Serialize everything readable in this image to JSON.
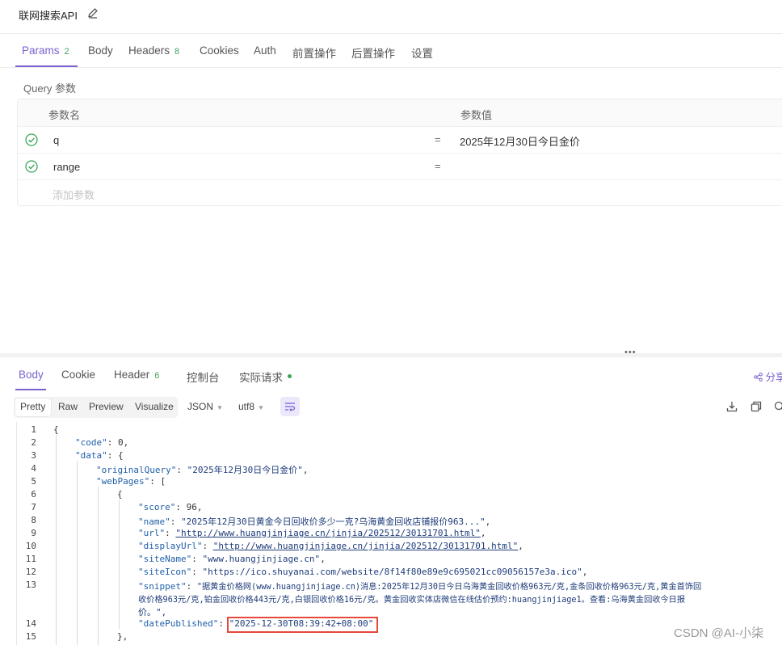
{
  "header": {
    "title": "联网搜索API"
  },
  "request_tabs": {
    "params": "Params",
    "params_count": "2",
    "body": "Body",
    "headers": "Headers",
    "headers_count": "8",
    "cookies": "Cookies",
    "auth": "Auth",
    "pre_ops": "前置操作",
    "post_ops": "后置操作",
    "settings": "设置"
  },
  "query": {
    "title": "Query 参数",
    "col_name": "参数名",
    "col_value": "参数值",
    "rows": [
      {
        "key": "q",
        "eq": "=",
        "value": "2025年12月30日今日金价"
      },
      {
        "key": "range",
        "eq": "=",
        "value": ""
      }
    ],
    "add_placeholder": "添加参数"
  },
  "splitter": {
    "dots": "•••"
  },
  "response_tabs": {
    "body": "Body",
    "cookie": "Cookie",
    "header": "Header",
    "header_count": "6",
    "console": "控制台",
    "actual_request": "实际请求",
    "share": "分享"
  },
  "toolbar": {
    "views": [
      "Pretty",
      "Raw",
      "Preview",
      "Visualize"
    ],
    "format": "JSON",
    "encoding": "utf8"
  },
  "code": {
    "line_numbers": [
      "1",
      "2",
      "3",
      "4",
      "5",
      "6",
      "7",
      "8",
      "9",
      "10",
      "11",
      "12",
      "13",
      "",
      "14",
      "15"
    ],
    "l1": "{",
    "l2_key": "\"code\"",
    "l2_val": "0",
    "l3_key": "\"data\"",
    "l3_rest": ": {",
    "l4_key": "\"originalQuery\"",
    "l4_val": "\"2025年12月30日今日金价\"",
    "l5_key": "\"webPages\"",
    "l5_rest": ": [",
    "l6": "{",
    "l7_key": "\"score\"",
    "l7_val": "96",
    "l8_key": "\"name\"",
    "l8_val": "\"2025年12月30日黄金今日回收价多少一克?乌海黄金回收店铺报价963...\"",
    "l9_key": "\"url\"",
    "l9_val": "\"http://www.huangjinjiage.cn/jinjia/202512/30131701.html\"",
    "l10_key": "\"displayUrl\"",
    "l10_val": "\"http://www.huangjinjiage.cn/jinjia/202512/30131701.html\"",
    "l11_key": "\"siteName\"",
    "l11_val": "\"www.huangjinjiage.cn\"",
    "l12_key": "\"siteIcon\"",
    "l12_val": "\"https://ico.shuyanai.com/website/8f14f80e89e9c695021cc09056157e3a.ico\"",
    "l13_key": "\"snippet\"",
    "l13_val_1": "\"据黄金价格网(www.huangjinjiage.cn)消息:2025年12月30日今日乌海黄金回收价格963元/克,金条回收价格963元/克,黄金首饰回",
    "l13_val_2": "收价格963元/克,铂金回收价格443元/克,白银回收价格16元/克。黄金回收实体店微信在线估价预约:huangjinjiage1。查看:乌海黄金回收今日报",
    "l13_val_3": "价。\",",
    "l14_key": "\"datePublished\"",
    "l14_val": "\"2025-12-30T08:39:42+08:00\"",
    "l15": "},"
  },
  "watermark": "CSDN @AI-小柒",
  "colors": {
    "accent": "#7b61d1",
    "success": "#3ba55c",
    "highlight": "#e5483c"
  }
}
